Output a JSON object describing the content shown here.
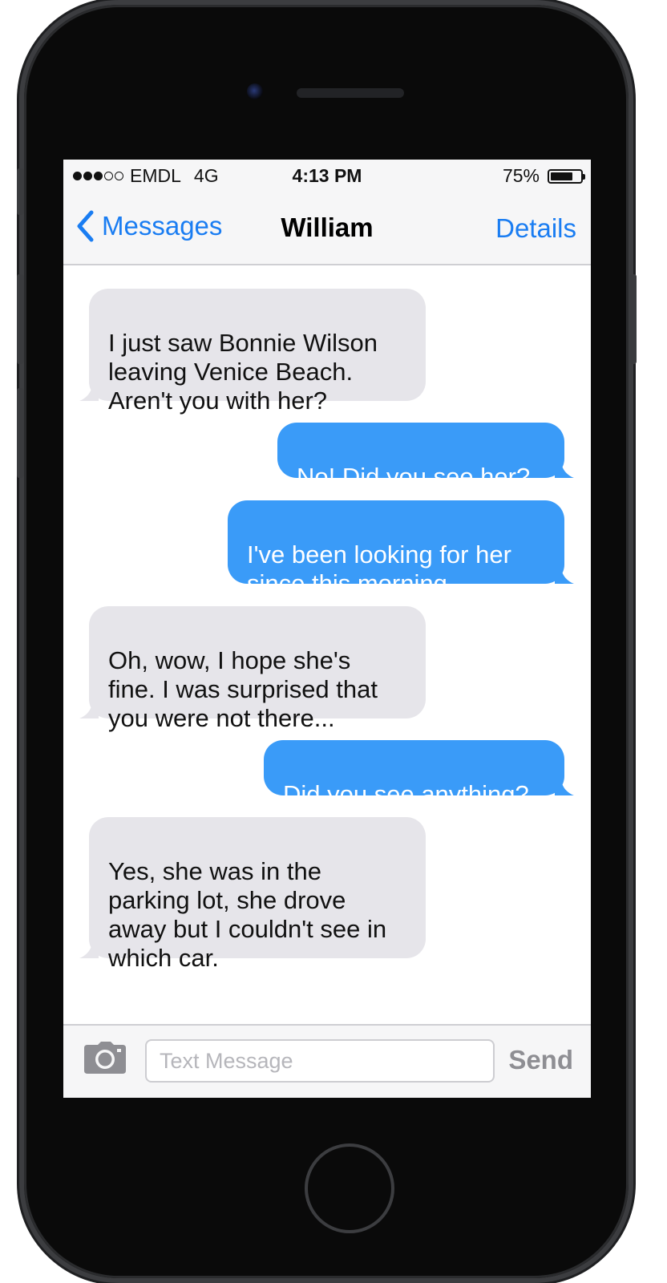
{
  "status_bar": {
    "carrier": "EMDL",
    "network": "4G",
    "time": "4:13 PM",
    "battery_text": "75%",
    "battery_level": 0.75,
    "signal_bars_filled": 3,
    "signal_bars_total": 5
  },
  "nav": {
    "back_label": "Messages",
    "title": "William",
    "details_label": "Details"
  },
  "messages": [
    {
      "direction": "incoming",
      "text": "I just saw Bonnie Wilson\nleaving Venice Beach.\nAren't you with her?"
    },
    {
      "direction": "outgoing",
      "text": "No! Did you see her?"
    },
    {
      "direction": "outgoing",
      "text": "I've been looking for her\nsince this morning"
    },
    {
      "direction": "incoming",
      "text": "Oh, wow, I hope she's\nfine. I was surprised that\nyou were not there..."
    },
    {
      "direction": "outgoing",
      "text": "Did you see anything?"
    },
    {
      "direction": "incoming",
      "text": "Yes, she was in the\nparking lot, she drove\naway but I couldn't see in\nwhich car."
    }
  ],
  "compose": {
    "placeholder": "Text Message",
    "value": "",
    "send_label": "Send"
  },
  "colors": {
    "accent": "#1a7df2",
    "outgoing_bubble": "#3a9bf8",
    "incoming_bubble": "#e6e5ea",
    "phone_body": "#0a0a0a"
  },
  "icons": {
    "back": "chevron-left-icon",
    "camera": "camera-icon"
  }
}
